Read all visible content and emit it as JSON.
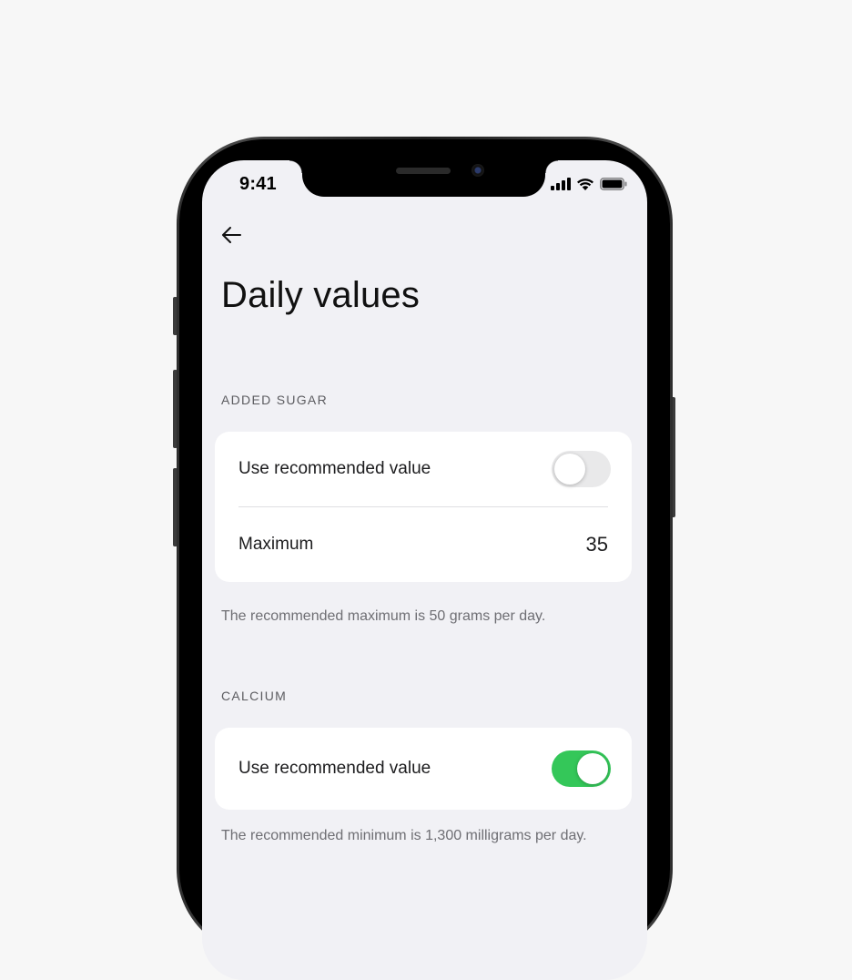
{
  "status_bar": {
    "time": "9:41",
    "icons": [
      "cellular-signal-icon",
      "wifi-icon",
      "battery-icon"
    ]
  },
  "nav": {
    "back_icon": "arrow-left-icon"
  },
  "page": {
    "title": "Daily values"
  },
  "sections": [
    {
      "header": "ADDED SUGAR",
      "rows": [
        {
          "label": "Use recommended value",
          "type": "toggle",
          "enabled": false
        },
        {
          "label": "Maximum",
          "type": "value",
          "value": "35"
        }
      ],
      "footnote": "The recommended maximum is 50 grams per day."
    },
    {
      "header": "CALCIUM",
      "rows": [
        {
          "label": "Use recommended value",
          "type": "toggle",
          "enabled": true
        }
      ],
      "footnote": "The recommended minimum is 1,300 milligrams per day."
    }
  ],
  "colors": {
    "toggle_on": "#34c759",
    "toggle_off": "#e9e9ea",
    "screen_background": "#f1f1f5",
    "card_background": "#ffffff"
  }
}
